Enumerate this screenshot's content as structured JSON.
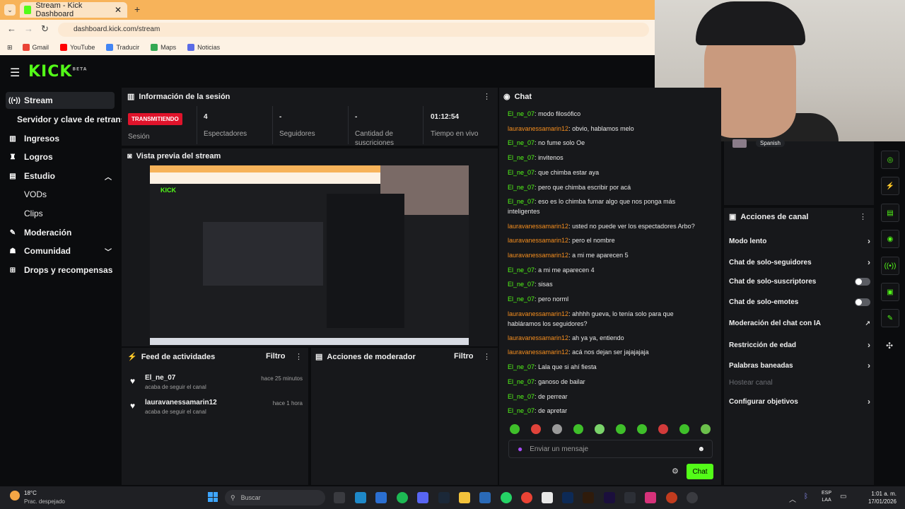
{
  "browser": {
    "tab_title": "Stream - Kick Dashboard",
    "tab_close": "✕",
    "new_tab": "+",
    "url": "dashboard.kick.com/stream",
    "bookmarks": [
      {
        "label": "Gmail",
        "color": "#ea4335"
      },
      {
        "label": "YouTube",
        "color": "#ff0000"
      },
      {
        "label": "Traducir",
        "color": "#4285f4"
      },
      {
        "label": "Maps",
        "color": "#34a853"
      },
      {
        "label": "Noticias",
        "color": "#5a6be6"
      }
    ]
  },
  "brand": {
    "logo": "KICK",
    "beta": "BETA",
    "accent": "#53fc18"
  },
  "sidebar": {
    "items": [
      {
        "label": "Stream",
        "icon": "broadcast-icon",
        "glyph": "((•))"
      },
      {
        "label": "Servidor y clave de retransmisión"
      },
      {
        "label": "Ingresos",
        "icon": "chart-icon",
        "glyph": "▥"
      },
      {
        "label": "Logros",
        "icon": "trophy-icon",
        "glyph": "♜"
      },
      {
        "label": "Estudio",
        "icon": "studio-icon",
        "glyph": "▤"
      },
      {
        "label": "VODs"
      },
      {
        "label": "Clips"
      },
      {
        "label": "Moderación",
        "icon": "wrench-icon",
        "glyph": "✎"
      },
      {
        "label": "Comunidad",
        "icon": "people-icon",
        "glyph": "☗"
      },
      {
        "label": "Drops y recompensas",
        "icon": "drops-icon",
        "glyph": "⊞"
      }
    ]
  },
  "session": {
    "title": "Información de la sesión",
    "status": "TRANSMITIENDO",
    "status_label": "Sesión",
    "stats": [
      {
        "value": "4",
        "label": "Espectadores"
      },
      {
        "value": "-",
        "label": "Seguidores"
      },
      {
        "value": "-",
        "label": "Cantidad de suscriciones"
      },
      {
        "value": "01:12:54",
        "label": "Tiempo en vivo"
      }
    ]
  },
  "preview": {
    "title": "Vista previa del stream"
  },
  "chat": {
    "title": "Chat",
    "messages": [
      {
        "user": "El_ne_07",
        "text": "modo filosófico",
        "c": "u1"
      },
      {
        "user": "lauravanessamarin12",
        "text": "obvio, hablamos melo",
        "c": "u2"
      },
      {
        "user": "El_ne_07",
        "text": "no fume solo Oe",
        "c": "u1"
      },
      {
        "user": "El_ne_07",
        "text": "invitenos",
        "c": "u1"
      },
      {
        "user": "El_ne_07",
        "text": "que chimba estar aya",
        "c": "u1"
      },
      {
        "user": "El_ne_07",
        "text": "pero que chimba escribir por acá",
        "c": "u1"
      },
      {
        "user": "El_ne_07",
        "text": "eso es lo chimba fumar algo que nos ponga más inteligentes",
        "c": "u1"
      },
      {
        "user": "lauravanessamarin12",
        "text": "usted no puede ver los espectadores Arbo?",
        "c": "u2"
      },
      {
        "user": "lauravanessamarin12",
        "text": "pero el nombre",
        "c": "u2"
      },
      {
        "user": "lauravanessamarin12",
        "text": "a mi me aparecen 5",
        "c": "u2"
      },
      {
        "user": "El_ne_07",
        "text": "a mi me aparecen 4",
        "c": "u1"
      },
      {
        "user": "El_ne_07",
        "text": "sisas",
        "c": "u1"
      },
      {
        "user": "El_ne_07",
        "text": "pero norml",
        "c": "u1"
      },
      {
        "user": "lauravanessamarin12",
        "text": "ahhhh gueva, lo tenía solo para que habláramos los seguidores?",
        "c": "u2"
      },
      {
        "user": "lauravanessamarin12",
        "text": "ah ya ya, entiendo",
        "c": "u2"
      },
      {
        "user": "lauravanessamarin12",
        "text": "acá nos dejan ser jajajajaja",
        "c": "u2"
      },
      {
        "user": "El_ne_07",
        "text": "Lala que si ahí fiesta",
        "c": "u1"
      },
      {
        "user": "El_ne_07",
        "text": "ganoso de bailar",
        "c": "u1"
      },
      {
        "user": "El_ne_07",
        "text": "de perrear",
        "c": "u1"
      },
      {
        "user": "El_ne_07",
        "text": "de apretar",
        "c": "u1"
      }
    ],
    "input_placeholder": "Enviar un mensaje",
    "send_label": "Chat"
  },
  "language_badge": "Spanish",
  "actions": {
    "title": "Acciones de canal",
    "items": [
      {
        "label": "Modo lento",
        "kind": "arrow"
      },
      {
        "label": "Chat de solo-seguidores",
        "kind": "arrow"
      },
      {
        "label": "Chat de solo-suscriptores",
        "kind": "toggle"
      },
      {
        "label": "Chat de solo-emotes",
        "kind": "toggle"
      },
      {
        "label": "Moderación del chat con IA",
        "kind": "ext"
      },
      {
        "label": "Restricción de edad",
        "kind": "arrow"
      },
      {
        "label": "Palabras baneadas",
        "kind": "arrow"
      },
      {
        "label": "Hostear canal",
        "kind": "disabled"
      },
      {
        "label": "Configurar objetivos",
        "kind": "arrow"
      }
    ]
  },
  "feed": {
    "title": "Feed de actividades",
    "filter": "Filtro",
    "items": [
      {
        "name": "El_ne_07",
        "desc": "acaba de seguir el canal",
        "time": "hace 25 minutos"
      },
      {
        "name": "lauravanessamarin12",
        "desc": "acaba de seguir el canal",
        "time": "hace 1 hora"
      }
    ]
  },
  "mod_actions": {
    "title": "Acciones de moderador",
    "filter": "Filtro"
  },
  "taskbar": {
    "weather_temp": "18°C",
    "weather_desc": "Prac. despejado",
    "search": "Buscar",
    "lang": "ESP",
    "lang_sub": "LAA",
    "time": "1:01 a. m.",
    "date": "17/01/2026"
  }
}
